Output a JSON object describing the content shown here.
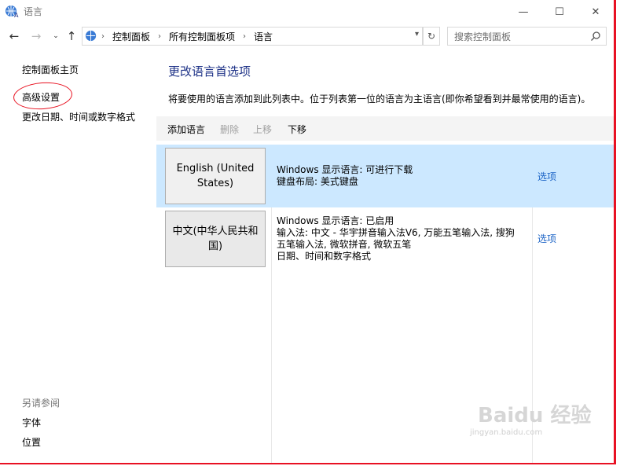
{
  "window": {
    "title": "语言"
  },
  "winbuttons": {
    "minimize": "—",
    "maximize": "☐",
    "close": "✕"
  },
  "address": {
    "crumbs": [
      "控制面板",
      "所有控制面板项",
      "语言"
    ],
    "search_placeholder": "搜索控制面板"
  },
  "sidebar": {
    "home": "控制面板主页",
    "advanced": "高级设置",
    "datetime": "更改日期、时间或数字格式",
    "see_also": "另请参阅",
    "fonts": "字体",
    "location": "位置"
  },
  "main": {
    "heading": "更改语言首选项",
    "description": "将要使用的语言添加到此列表中。位于列表第一位的语言为主语言(即你希望看到并最常使用的语言)。",
    "toolbar": {
      "add": "添加语言",
      "remove": "删除",
      "up": "上移",
      "down": "下移"
    },
    "languages": [
      {
        "name": "English (United States)",
        "line1": "Windows 显示语言: 可进行下载",
        "line2": "键盘布局: 美式键盘",
        "line3": "",
        "line4": "",
        "options": "选项"
      },
      {
        "name": "中文(中华人民共和国)",
        "line1": "Windows 显示语言: 已启用",
        "line2": "输入法: 中文 - 华宇拼音输入法V6, 万能五笔输入法, 搜狗",
        "line3": "五笔输入法, 微软拼音, 微软五笔",
        "line4": "日期、时间和数字格式",
        "options": "选项"
      }
    ]
  },
  "watermark": {
    "brand": "Baidu 经验",
    "url": "jingyan.baidu.com"
  },
  "colors": {
    "accent_link": "#1b63c6",
    "heading": "#1e3287",
    "selected_row": "#cce8ff",
    "annotation_red": "#e8101f"
  }
}
